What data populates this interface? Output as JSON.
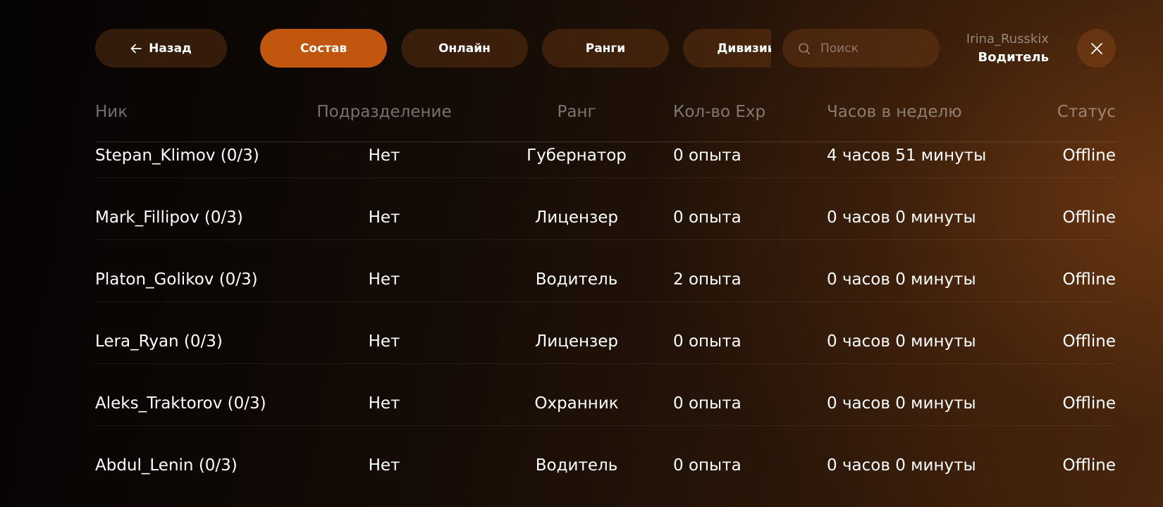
{
  "nav": {
    "back_label": "Назад",
    "tabs": [
      {
        "label": "Состав",
        "active": true
      },
      {
        "label": "Онлайн",
        "active": false
      },
      {
        "label": "Ранги",
        "active": false
      },
      {
        "label": "Дивизии",
        "active": false
      }
    ]
  },
  "search": {
    "placeholder": "Поиск",
    "value": ""
  },
  "user": {
    "name": "Irina_Russkix",
    "role": "Водитель"
  },
  "table": {
    "headers": [
      "Ник",
      "Подразделение",
      "Ранг",
      "Кол-во Exp",
      "Часов в неделю",
      "Статус"
    ],
    "rows": [
      {
        "nick": "Stepan_Klimov (0/3)",
        "division": "Нет",
        "rank": "Губернатор",
        "exp": "0 опыта",
        "hours": "4 часов 51 минуты",
        "status": "Offline"
      },
      {
        "nick": "Mark_Fillipov (0/3)",
        "division": "Нет",
        "rank": "Лицензер",
        "exp": "0 опыта",
        "hours": "0 часов 0 минуты",
        "status": "Offline"
      },
      {
        "nick": "Platon_Golikov (0/3)",
        "division": "Нет",
        "rank": "Водитель",
        "exp": "2 опыта",
        "hours": "0 часов 0 минуты",
        "status": "Offline"
      },
      {
        "nick": "Lera_Ryan (0/3)",
        "division": "Нет",
        "rank": "Лицензер",
        "exp": "0 опыта",
        "hours": "0 часов 0 минуты",
        "status": "Offline"
      },
      {
        "nick": "Aleks_Traktorov (0/3)",
        "division": "Нет",
        "rank": "Охранник",
        "exp": "0 опыта",
        "hours": "0 часов 0 минуты",
        "status": "Offline"
      },
      {
        "nick": "Abdul_Lenin (0/3)",
        "division": "Нет",
        "rank": "Водитель",
        "exp": "0 опыта",
        "hours": "0 часов 0 минуты",
        "status": "Offline"
      }
    ]
  },
  "icons": {
    "back": "arrow-left-icon",
    "search": "search-icon",
    "close": "close-icon"
  },
  "colors": {
    "accent": "#c1570f",
    "pill": "#4a2a12",
    "text": "#ffffff",
    "muted": "#8a7f78"
  }
}
